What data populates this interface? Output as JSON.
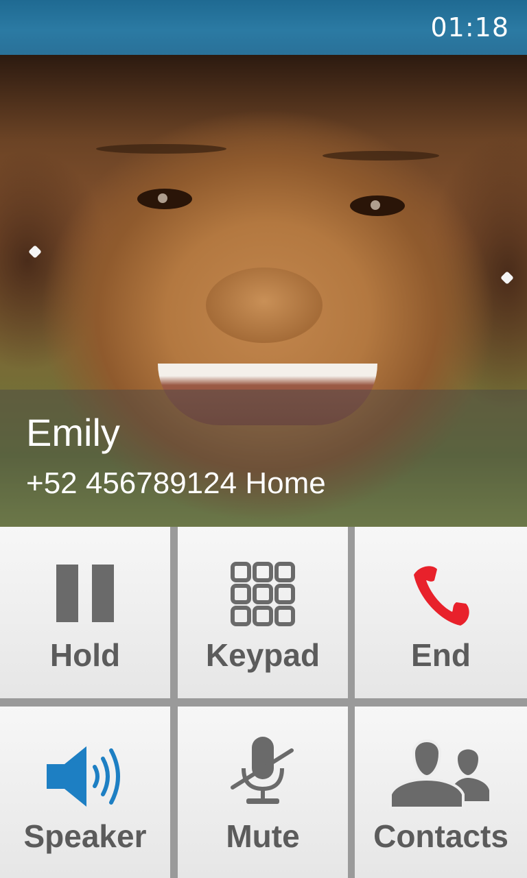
{
  "status_bar": {
    "time": "01:18"
  },
  "caller": {
    "name": "Emily",
    "number": "+52 456789124 Home"
  },
  "buttons": [
    {
      "label": "Hold",
      "icon": "pause-icon"
    },
    {
      "label": "Keypad",
      "icon": "keypad-icon"
    },
    {
      "label": "End",
      "icon": "end-call-icon"
    },
    {
      "label": "Speaker",
      "icon": "speaker-icon"
    },
    {
      "label": "Mute",
      "icon": "mute-microphone-icon"
    },
    {
      "label": "Contacts",
      "icon": "contacts-icon"
    }
  ],
  "colors": {
    "end_call": "#e8212b",
    "speaker_active": "#1d7fc3",
    "icon_gray": "#6a6a6a",
    "status_bar": "#2a7199"
  }
}
